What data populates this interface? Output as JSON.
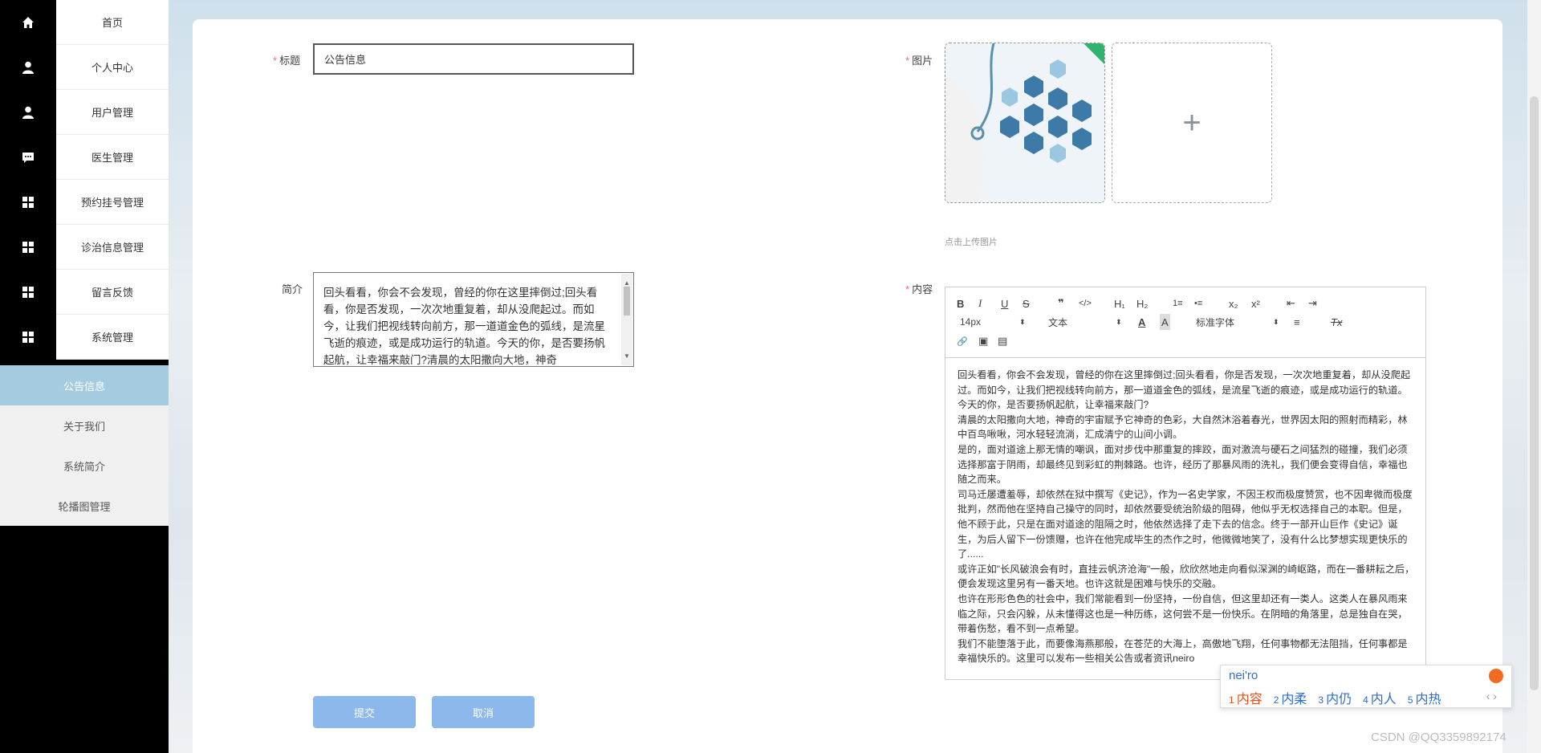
{
  "sidebar": {
    "menu": [
      {
        "label": "首页",
        "icon": "home-icon"
      },
      {
        "label": "个人中心",
        "icon": "user-icon"
      },
      {
        "label": "用户管理",
        "icon": "user-icon"
      },
      {
        "label": "医生管理",
        "icon": "chat-icon"
      },
      {
        "label": "预约挂号管理",
        "icon": "grid-icon"
      },
      {
        "label": "诊治信息管理",
        "icon": "grid-icon"
      },
      {
        "label": "留言反馈",
        "icon": "grid-icon"
      },
      {
        "label": "系统管理",
        "icon": "grid-icon"
      }
    ],
    "submenu": [
      {
        "label": "公告信息",
        "active": true
      },
      {
        "label": "关于我们",
        "active": false
      },
      {
        "label": "系统简介",
        "active": false
      },
      {
        "label": "轮播图管理",
        "active": false
      }
    ]
  },
  "form": {
    "title_label": "标题",
    "title_value": "公告信息",
    "intro_label": "简介",
    "intro_value": "回头看看，你会不会发现，曾经的你在这里摔倒过;回头看看，你是否发现，一次次地重复着，却从没爬起过。而如今，让我们把视线转向前方，那一道道金色的弧线，是流星飞逝的痕迹，或是成功运行的轨道。今天的你，是否要扬帆起航，让幸福来敲门?清晨的太阳撒向大地，神奇",
    "image_label": "图片",
    "upload_tip": "点击上传图片",
    "upload_plus": "+",
    "content_label": "内容",
    "required_mark": "*"
  },
  "editor": {
    "toolbar": {
      "bold": "B",
      "italic": "I",
      "underline": "U",
      "strike": "S",
      "quote": "❞",
      "code": "</>",
      "h1": "H₁",
      "h2": "H₂",
      "ol": "1≡",
      "ul": "•≡",
      "sub": "x₂",
      "sup": "x²",
      "outdent": "⇤",
      "indent": "⇥",
      "size": "14px",
      "header": "文本",
      "color": "A",
      "bg": "A",
      "font": "标准字体",
      "align": "≡",
      "clean": "Tx",
      "link": "🔗",
      "image": "▣",
      "video": "▤"
    },
    "paragraphs": [
      "回头看看，你会不会发现，曾经的你在这里摔倒过;回头看看，你是否发现，一次次地重复着，却从没爬起过。而如今，让我们把视线转向前方，那一道道金色的弧线，是流星飞逝的痕迹，或是成功运行的轨道。今天的你，是否要扬帆起航，让幸福来敲门?",
      "清晨的太阳撒向大地，神奇的宇宙赋予它神奇的色彩，大自然沐浴着春光，世界因太阳的照射而精彩，林中百鸟啾啾，河水轻轻流淌，汇成清宁的山间小调。",
      "是的，面对道途上那无情的嘲讽，面对步伐中那重复的摔跤，面对激流与硬石之间猛烈的碰撞，我们必须选择那富于阴雨，却最终见到彩虹的荆棘路。也许，经历了那暴风雨的洗礼，我们便会变得自信，幸福也随之而来。",
      "司马迁屡遭羞辱，却依然在狱中撰写《史记》，作为一名史学家，不因王权而极度赞赏，也不因卑微而极度批判，然而他在坚持自己操守的同时，却依然要受统治阶级的阻碍，他似乎无权选择自己的本职。但是，他不顾于此，只是在面对道途的阻隔之时，他依然选择了走下去的信念。终于一部开山巨作《史记》诞生，为后人留下一份馈赠，也许在他完成毕生的杰作之时，他微微地笑了，没有什么比梦想实现更快乐的了......",
      "或许正如\"长风破浪会有时，直挂云帆济沧海\"一般，欣欣然地走向看似深渊的崎岖路，而在一番耕耘之后，便会发现这里另有一番天地。也许这就是困难与快乐的交融。",
      "也许在形形色色的社会中，我们常能看到一份坚持，一份自信，但这里却还有一类人。这类人在暴风雨来临之际，只会闪躲，从未懂得这也是一种历练，这何尝不是一份快乐。在阴暗的角落里，总是独自在哭，带着伤愁，看不到一点希望。",
      "我们不能堕落于此，而要像海燕那般，在苍茫的大海上，高傲地飞翔，任何事物都无法阻挡，任何事都是幸福快乐的。这里可以发布一些相关公告或者资讯neiro"
    ]
  },
  "ime": {
    "input": "nei'ro",
    "candidates": [
      {
        "num": "1",
        "text": "内容"
      },
      {
        "num": "2",
        "text": "内柔"
      },
      {
        "num": "3",
        "text": "内仍"
      },
      {
        "num": "4",
        "text": "内人"
      },
      {
        "num": "5",
        "text": "内热"
      }
    ],
    "nav": "‹ ›"
  },
  "buttons": {
    "submit": "提交",
    "cancel": "取消"
  },
  "watermark": "CSDN @QQ3359892174",
  "colors": {
    "accent": "#a4cbe0",
    "button": "#8cb8ec",
    "required": "#f56c6c"
  }
}
